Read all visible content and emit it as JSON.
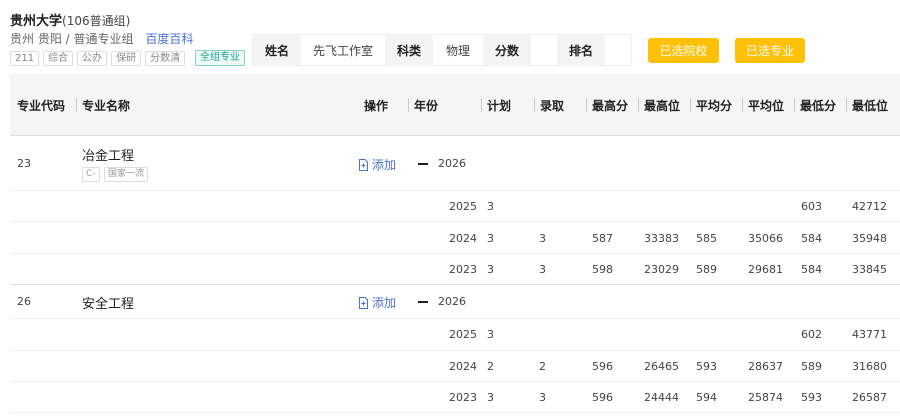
{
  "header": {
    "university": "贵州大学",
    "group": "(106普通组)",
    "location": "贵州 贵阳 / 普通专业组",
    "wiki_link": "百度百科",
    "tags": [
      "211",
      "综合",
      "公办",
      "保研",
      "分数清"
    ],
    "group_tag": "全组专业"
  },
  "info": {
    "name_label": "姓名",
    "name_value": "先飞工作室",
    "subject_label": "科类",
    "subject_value": "物理",
    "score_label": "分数",
    "score_value": "",
    "rank_label": "排名",
    "rank_value": ""
  },
  "buttons": {
    "selected_schools": "已选院校",
    "selected_majors": "已选专业"
  },
  "table": {
    "headers": {
      "code": "专业代码",
      "name": "专业名称",
      "action": "操作",
      "year": "年份",
      "plan": "计划",
      "admit": "录取",
      "max_score": "最高分",
      "max_rank": "最高位",
      "avg_score": "平均分",
      "avg_rank": "平均位",
      "min_score": "最低分",
      "min_rank": "最低位"
    },
    "majors": [
      {
        "code": "23",
        "name": "冶金工程",
        "tags": [
          "C-",
          "国家一流"
        ],
        "action": "添加",
        "current_year": "2026",
        "rows": [
          {
            "year": "2025",
            "plan": "3",
            "admit": "",
            "max_score": "",
            "max_rank": "",
            "avg_score": "",
            "avg_rank": "",
            "min_score": "603",
            "min_rank": "42712"
          },
          {
            "year": "2024",
            "plan": "3",
            "admit": "3",
            "max_score": "587",
            "max_rank": "33383",
            "avg_score": "585",
            "avg_rank": "35066",
            "min_score": "584",
            "min_rank": "35948"
          },
          {
            "year": "2023",
            "plan": "3",
            "admit": "3",
            "max_score": "598",
            "max_rank": "23029",
            "avg_score": "589",
            "avg_rank": "29681",
            "min_score": "584",
            "min_rank": "33845"
          }
        ]
      },
      {
        "code": "26",
        "name": "安全工程",
        "tags": [],
        "action": "添加",
        "current_year": "2026",
        "rows": [
          {
            "year": "2025",
            "plan": "3",
            "admit": "",
            "max_score": "",
            "max_rank": "",
            "avg_score": "",
            "avg_rank": "",
            "min_score": "602",
            "min_rank": "43771"
          },
          {
            "year": "2024",
            "plan": "2",
            "admit": "2",
            "max_score": "596",
            "max_rank": "26465",
            "avg_score": "593",
            "avg_rank": "28637",
            "min_score": "589",
            "min_rank": "31680"
          },
          {
            "year": "2023",
            "plan": "3",
            "admit": "3",
            "max_score": "596",
            "max_rank": "24444",
            "avg_score": "594",
            "avg_rank": "25874",
            "min_score": "593",
            "min_rank": "26587"
          }
        ]
      }
    ]
  },
  "colors": {
    "accent": "#ffc107",
    "link": "#4a6fd6",
    "group_tag": "#1aa58a"
  },
  "icons": {
    "add": "add-file-icon",
    "collapse": "collapse-minus-icon"
  }
}
